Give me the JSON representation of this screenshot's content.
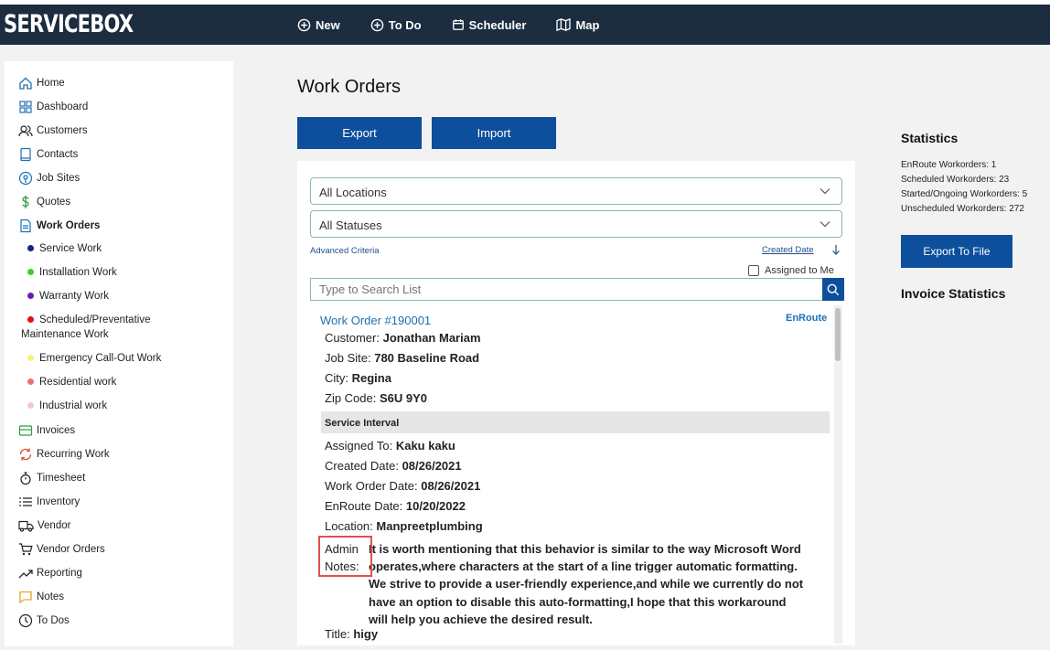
{
  "app": {
    "logo": "SERVICEBOX"
  },
  "topnav": [
    {
      "label": "New",
      "icon": "plus-circle-icon"
    },
    {
      "label": "To Do",
      "icon": "plus-circle-icon"
    },
    {
      "label": "Scheduler",
      "icon": "calendar-icon"
    },
    {
      "label": "Map",
      "icon": "map-icon"
    }
  ],
  "sidebar": {
    "items": [
      {
        "label": "Home",
        "icon": "home-icon"
      },
      {
        "label": "Dashboard",
        "icon": "grid-icon"
      },
      {
        "label": "Customers",
        "icon": "users-icon"
      },
      {
        "label": "Contacts",
        "icon": "book-icon"
      },
      {
        "label": "Job Sites",
        "icon": "location-pin-icon"
      },
      {
        "label": "Quotes",
        "icon": "dollar-icon"
      },
      {
        "label": "Work Orders",
        "icon": "document-icon"
      }
    ],
    "sub_items": [
      {
        "label": "Service Work",
        "color": "#1a237e"
      },
      {
        "label": "Installation Work",
        "color": "#3ecf2b"
      },
      {
        "label": "Warranty Work",
        "color": "#6a1bb5"
      },
      {
        "label": "Scheduled/Preventative",
        "label2": "Maintenance Work",
        "color": "#e01010"
      },
      {
        "label": "Emergency Call-Out Work",
        "color": "#f5f27a"
      },
      {
        "label": "Residential work",
        "color": "#f07070"
      },
      {
        "label": "Industrial work",
        "color": "#f7c6cc"
      }
    ],
    "items2": [
      {
        "label": "Invoices",
        "icon": "invoice-icon"
      },
      {
        "label": "Recurring Work",
        "icon": "recurring-icon"
      },
      {
        "label": "Timesheet",
        "icon": "stopwatch-icon"
      },
      {
        "label": "Inventory",
        "icon": "list-icon"
      },
      {
        "label": "Vendor",
        "icon": "truck-icon"
      },
      {
        "label": "Vendor Orders",
        "icon": "cart-icon"
      },
      {
        "label": "Reporting",
        "icon": "trend-icon"
      },
      {
        "label": "Notes",
        "icon": "note-icon"
      },
      {
        "label": "To Dos",
        "icon": "clock-icon"
      }
    ]
  },
  "main": {
    "title": "Work Orders",
    "export_label": "Export",
    "import_label": "Import",
    "location_select": "All Locations",
    "status_select": "All Statuses",
    "advanced_criteria": "Advanced Criteria",
    "sort_label": "Created Date",
    "assigned_to_me": "Assigned to Me",
    "search_placeholder": "Type to Search List"
  },
  "work_order": {
    "title": "Work Order #190001",
    "status": "EnRoute",
    "customer_label": "Customer:",
    "customer": "Jonathan Mariam",
    "jobsite_label": "Job Site:",
    "jobsite": "780 Baseline Road",
    "city_label": "City:",
    "city": "Regina",
    "zip_label": "Zip Code:",
    "zip": "S6U 9Y0",
    "section": "Service Interval",
    "assigned_label": "Assigned To:",
    "assigned": "Kaku kaku",
    "created_label": "Created Date:",
    "created": "08/26/2021",
    "wodate_label": "Work Order Date:",
    "wodate": "08/26/2021",
    "enroute_label": "EnRoute Date:",
    "enroute": "10/20/2022",
    "location_label": "Location:",
    "location": "Manpreetplumbing",
    "admin_label_1": "Admin",
    "admin_label_2": "Notes:",
    "admin_notes": [
      "It is worth mentioning that this behavior is similar to the way Microsoft Word",
      "operates,where characters at the start of a line trigger automatic formatting.",
      "We strive to provide a user-friendly experience,and while we currently do not",
      "have an option to disable this auto-formatting,I hope that this workaround",
      "will help you achieve the desired result."
    ],
    "title_label": "Title:",
    "title_value": "higy"
  },
  "stats": {
    "heading": "Statistics",
    "lines": [
      "EnRoute Workorders: 1",
      "Scheduled Workorders: 23",
      "Started/Ongoing Workorders: 5",
      "Unscheduled Workorders: 272"
    ],
    "export_to_file": "Export To File",
    "invoice_heading": "Invoice Statistics"
  }
}
